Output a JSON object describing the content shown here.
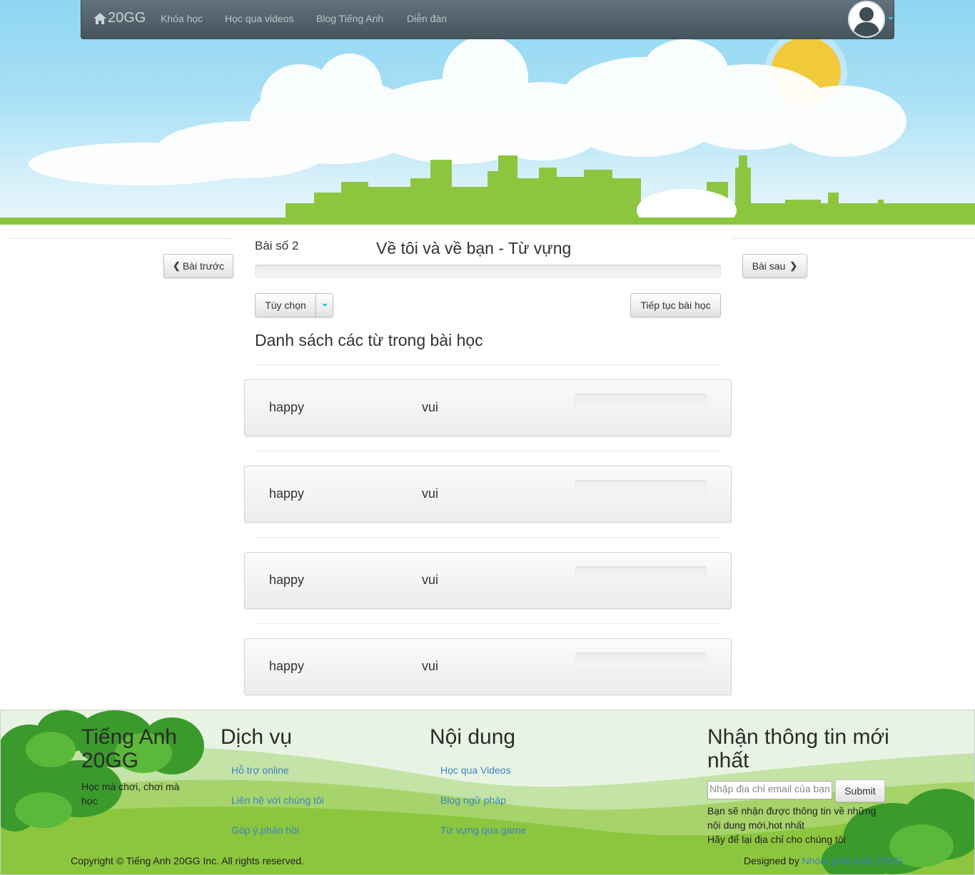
{
  "navbar": {
    "brand": "20GG",
    "links": [
      "Khóa học",
      "Học qua videos",
      "Blog Tiếng Anh",
      "Diễn đàn"
    ]
  },
  "lesson": {
    "prev_label": "Bài trước",
    "next_label": "Bài sau",
    "number": "Bài số 2",
    "title": "Về tôi và về bạn - Từ vựng",
    "progress": 0,
    "options_label": "Tùy chọn",
    "continue_label": "Tiếp tục bài học",
    "list_title": "Danh sách các từ trong bài học",
    "words": [
      {
        "en": "happy",
        "vi": "vui"
      },
      {
        "en": "happy",
        "vi": "vui"
      },
      {
        "en": "happy",
        "vi": "vui"
      },
      {
        "en": "happy",
        "vi": "vui"
      }
    ]
  },
  "footer": {
    "about": {
      "title": "Tiếng Anh 20GG",
      "tagline": "Học mà chơi, chơi mà học"
    },
    "services": {
      "title": "Dịch vụ",
      "links": [
        "Hỗ trợ online",
        "Liên hệ với chúng tôi",
        "Góp ý,phản hồi"
      ]
    },
    "content": {
      "title": "Nội dung",
      "links": [
        "Học qua Videos",
        "Blog ngữ pháp",
        "Từ vựng qua game"
      ]
    },
    "newsletter": {
      "title": "Nhận thông tin mới nhất",
      "placeholder": "Nhập địa chỉ email của bạn",
      "submit": "Submit",
      "note1": "Bạn sẽ nhận được thông tin về những nội dung mới,hot nhất",
      "note2": "Hãy để lại địa chỉ cho chúng tôi"
    },
    "copyright": "Copyright © Tiếng Anh 20GG Inc. All rights reserved.",
    "designed_prefix": "Designed by",
    "designed_link": "Nhóm phát triển 20GG"
  },
  "colors": {
    "accent": "#33c4e8",
    "link": "#3b83c0",
    "grass": "#8cc63f",
    "sun": "#f2c93b"
  }
}
